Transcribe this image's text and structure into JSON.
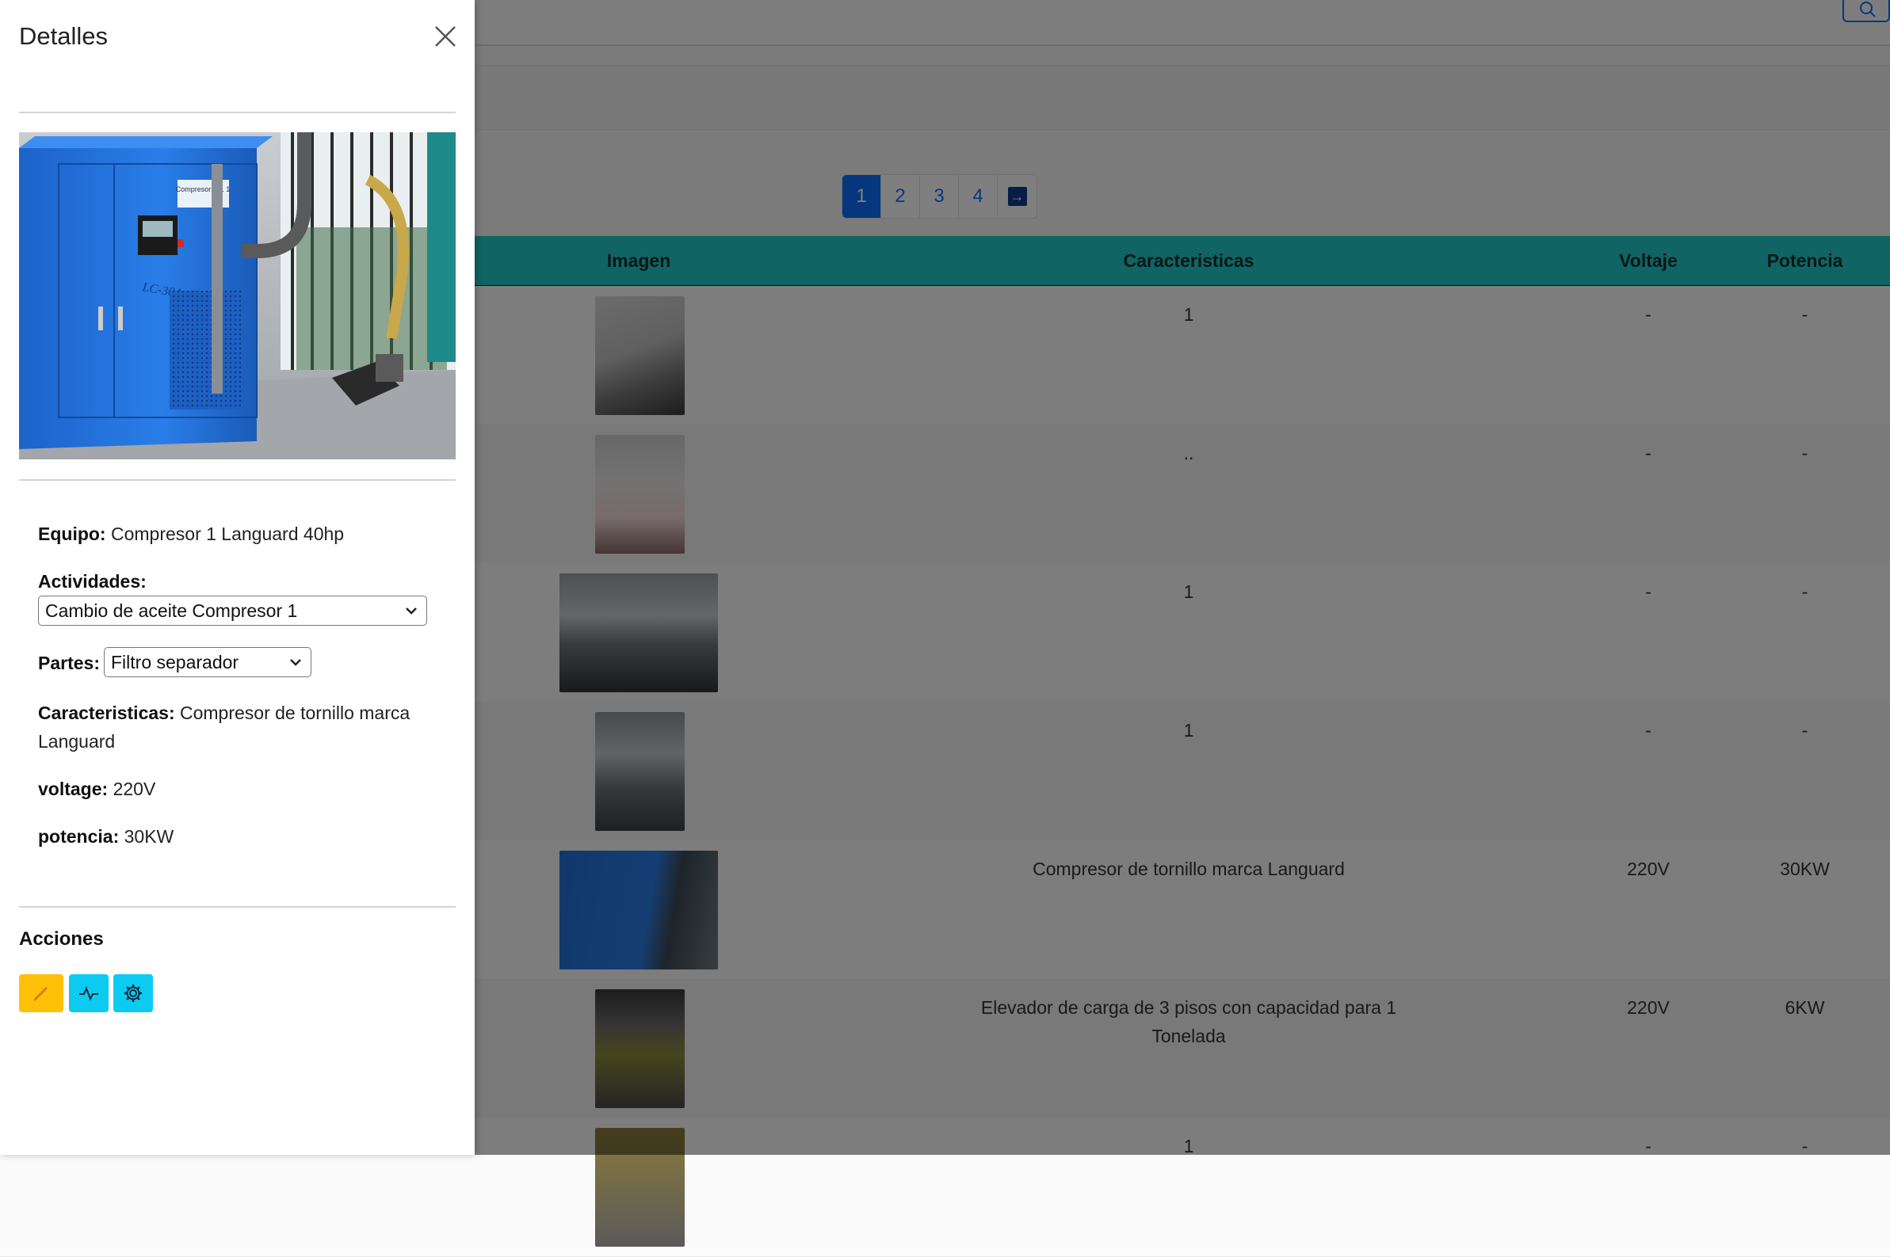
{
  "panel": {
    "title": "Detalles",
    "equipo_label": "Equipo:",
    "equipo_value": "Compresor 1 Languard 40hp",
    "actividades_label": "Actividades:",
    "actividades_selected": "Cambio de aceite Compresor 1",
    "partes_label": "Partes:",
    "partes_selected": "Filtro separador",
    "caracteristicas_label": "Caracteristicas:",
    "caracteristicas_value": "Compresor de tornillo marca Languard",
    "voltage_label": "voltage:",
    "voltage_value": "220V",
    "potencia_label": "potencia:",
    "potencia_value": "30KW",
    "acciones_label": "Acciones",
    "photo_plate_label": "Compresor No. 1",
    "photo_model_label": "LC-30A",
    "action_buttons": [
      {
        "icon": "pencil-icon",
        "color": "#ffc107"
      },
      {
        "icon": "activity-icon",
        "color": "#0dcaf0"
      },
      {
        "icon": "gear-icon",
        "color": "#0dcaf0"
      }
    ]
  },
  "pagination": {
    "pages": [
      "1",
      "2",
      "3",
      "4"
    ],
    "active": "1",
    "next_icon": "arrow-right-icon"
  },
  "table": {
    "headers": {
      "imagen": "Imagen",
      "caracteristicas": "Caracteristicas",
      "voltaje": "Voltaje",
      "potencia": "Potencia"
    },
    "rows": [
      {
        "caracteristicas": "1",
        "voltaje": "-",
        "potencia": "-"
      },
      {
        "caracteristicas": "..",
        "voltaje": "-",
        "potencia": "-"
      },
      {
        "caracteristicas": "1",
        "voltaje": "-",
        "potencia": "-"
      },
      {
        "caracteristicas": "1",
        "voltaje": "-",
        "potencia": "-"
      },
      {
        "caracteristicas": "Compresor de tornillo marca Languard",
        "voltaje": "220V",
        "potencia": "30KW"
      },
      {
        "caracteristicas": "Elevador de carga de 3 pisos con capacidad para 1 Tonelada",
        "voltaje": "220V",
        "potencia": "6KW"
      },
      {
        "caracteristicas": "1",
        "voltaje": "-",
        "potencia": "-"
      }
    ]
  },
  "colors": {
    "accent": "#0d6efd",
    "table_header": "#20c9c9",
    "warning": "#ffc107",
    "info": "#0dcaf0"
  }
}
